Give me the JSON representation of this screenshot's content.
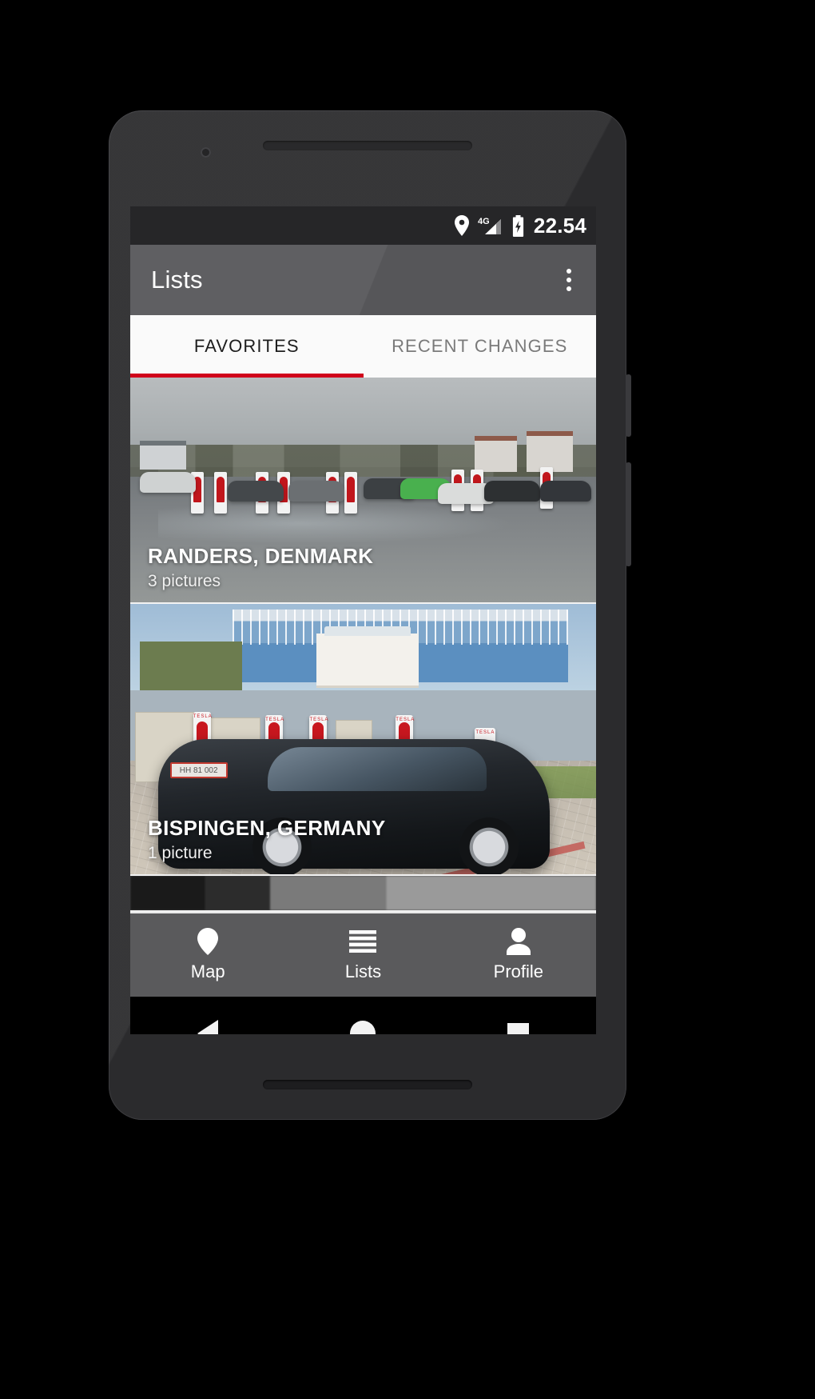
{
  "status_bar": {
    "clock": "22.54",
    "icons": [
      "location-pin-icon",
      "signal-4g-icon",
      "battery-charging-icon"
    ],
    "network_label": "4G",
    "background": "#262628"
  },
  "app_bar": {
    "title": "Lists",
    "overflow_menu": "overflow-menu-icon",
    "background": "#565659"
  },
  "tabs": {
    "items": [
      {
        "label": "FAVORITES",
        "active": true
      },
      {
        "label": "RECENT CHANGES",
        "active": false
      }
    ],
    "indicator_color": "#d0021b"
  },
  "list": {
    "cards": [
      {
        "title": "RANDERS, DENMARK",
        "subtitle": "3 pictures",
        "photo": "tesla-supercharger-overcast-parking-lot"
      },
      {
        "title": "BISPINGEN, GERMANY",
        "subtitle": "1 picture",
        "photo": "black-tesla-model-s-at-supercharger",
        "plate_text": "HH 81 002"
      },
      {
        "title": "",
        "subtitle": "",
        "photo": "partially-visible-next-card"
      }
    ]
  },
  "bottom_nav": {
    "items": [
      {
        "label": "Map",
        "icon": "map-pin-icon",
        "active": false
      },
      {
        "label": "Lists",
        "icon": "list-lines-icon",
        "active": true
      },
      {
        "label": "Profile",
        "icon": "person-icon",
        "active": false
      }
    ],
    "background": "#5a5a5c"
  },
  "system_nav": {
    "items": [
      {
        "name": "back",
        "icon": "back-triangle-icon"
      },
      {
        "name": "home",
        "icon": "home-circle-icon"
      },
      {
        "name": "recents",
        "icon": "recents-square-icon"
      }
    ]
  }
}
